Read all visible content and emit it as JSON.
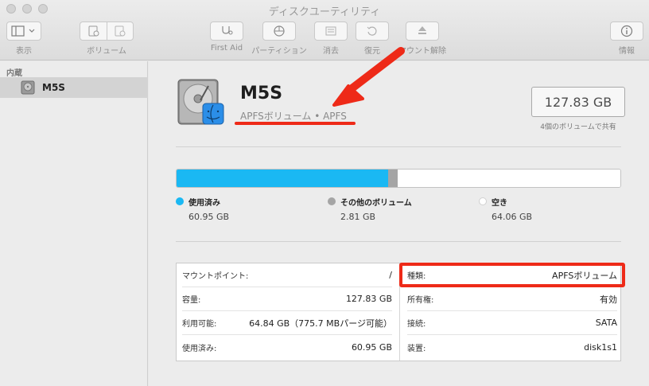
{
  "window": {
    "title": "ディスクユーティリティ"
  },
  "toolbar": {
    "view_label": "表示",
    "volume_label": "ボリューム",
    "firstaid_label": "First Aid",
    "partition_label": "パーティション",
    "erase_label": "消去",
    "restore_label": "復元",
    "unmount_label": "マウント解除",
    "info_label": "情報"
  },
  "sidebar": {
    "heading": "内蔵",
    "items": [
      {
        "label": "M5S"
      }
    ]
  },
  "volume": {
    "name": "M5S",
    "subtitle": "APFSボリューム • APFS",
    "capacity": "127.83 GB",
    "shared_note": "4個のボリュームで共有"
  },
  "usage": {
    "segments": [
      {
        "name": "使用済み",
        "value": "60.95 GB",
        "fraction": 0.4768,
        "color": "#1ab8f3"
      },
      {
        "name": "その他のボリューム",
        "value": "2.81 GB",
        "fraction": 0.022,
        "color": "#a5a5a5"
      },
      {
        "name": "空き",
        "value": "64.06 GB",
        "fraction": 0.5012,
        "color": "#ffffff"
      }
    ]
  },
  "info": {
    "left": [
      {
        "key": "マウントポイント:",
        "value": "/"
      },
      {
        "key": "容量:",
        "value": "127.83 GB"
      },
      {
        "key": "利用可能:",
        "value": "64.84 GB（775.7 MBパージ可能）"
      },
      {
        "key": "使用済み:",
        "value": "60.95 GB"
      }
    ],
    "right": [
      {
        "key": "種類:",
        "value": "APFSボリューム"
      },
      {
        "key": "所有権:",
        "value": "有効"
      },
      {
        "key": "接続:",
        "value": "SATA"
      },
      {
        "key": "装置:",
        "value": "disk1s1"
      }
    ]
  },
  "annotation": {
    "color": "#ee2a18"
  }
}
